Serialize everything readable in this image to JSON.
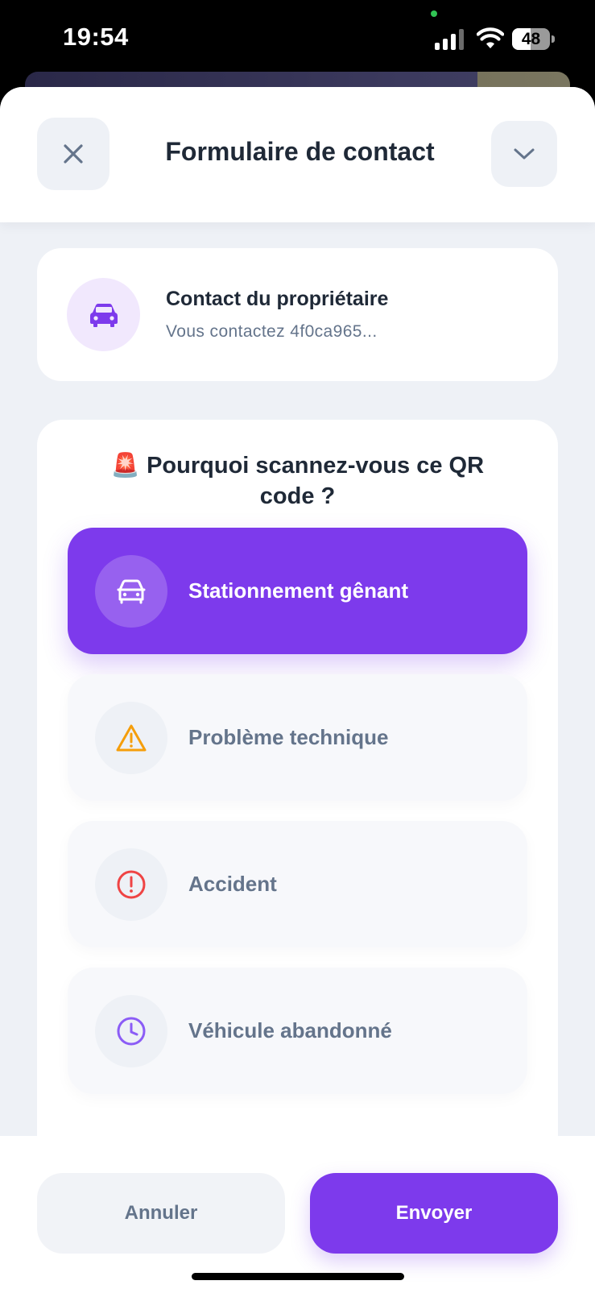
{
  "status_bar": {
    "time": "19:54",
    "battery_level": "48",
    "battery_fraction": 0.48
  },
  "header": {
    "title": "Formulaire de contact",
    "close_icon": "close-icon",
    "collapse_icon": "chevron-down-icon"
  },
  "owner": {
    "title": "Contact du propriétaire",
    "subtitle": "Vous contactez 4f0ca965...",
    "icon": "car-icon"
  },
  "reasons": {
    "question": "🚨 Pourquoi scannez-vous ce QR code ?",
    "options": [
      {
        "label": "Stationnement gênant",
        "icon": "car-icon",
        "selected": true
      },
      {
        "label": "Problème technique",
        "icon": "warning-triangle-icon",
        "selected": false
      },
      {
        "label": "Accident",
        "icon": "alert-circle-icon",
        "selected": false
      },
      {
        "label": "Véhicule abandonné",
        "icon": "clock-icon",
        "selected": false
      }
    ]
  },
  "footer": {
    "cancel_label": "Annuler",
    "send_label": "Envoyer"
  },
  "colors": {
    "accent": "#7d3aec",
    "warning": "#f59e0b",
    "danger": "#ef4444",
    "muted_text": "#64748b",
    "title_text": "#1f2937"
  }
}
